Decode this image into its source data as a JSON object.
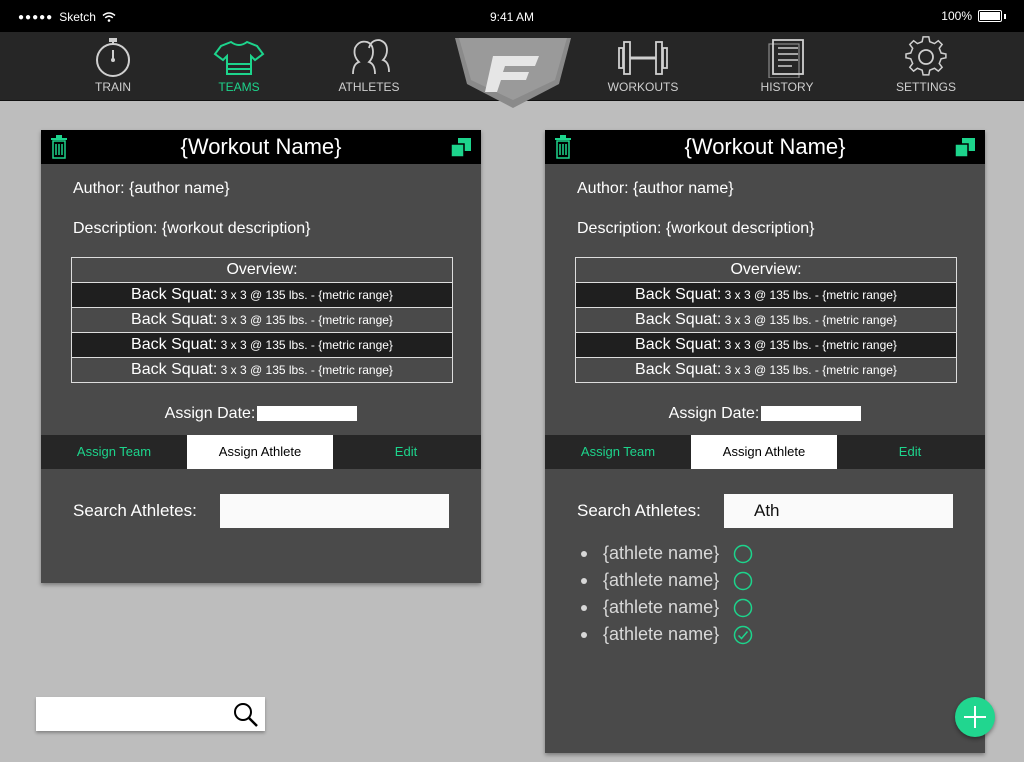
{
  "status_bar": {
    "carrier": "Sketch",
    "time": "9:41 AM",
    "battery": "100%"
  },
  "nav": {
    "items": [
      {
        "label": "TRAIN",
        "icon": "stopwatch-icon"
      },
      {
        "label": "TEAMS",
        "icon": "shirt-icon",
        "active": true
      },
      {
        "label": "ATHLETES",
        "icon": "athletes-icon"
      },
      {
        "label": "WORKOUTS",
        "icon": "barbell-icon"
      },
      {
        "label": "HISTORY",
        "icon": "document-icon"
      },
      {
        "label": "SETTINGS",
        "icon": "gear-icon"
      }
    ],
    "logo": "F"
  },
  "colors": {
    "accent": "#1dd48c",
    "panel": "#4a4a4a",
    "header": "#000000",
    "nav": "#262626"
  },
  "cards": [
    {
      "title": "{Workout Name}",
      "author": "Author: {author name}",
      "description": "Description: {workout description}",
      "overview_title": "Overview:",
      "overview_rows": [
        {
          "exercise": "Back Squat:",
          "detail": " 3 x 3 @ 135 lbs. - {metric range}"
        },
        {
          "exercise": "Back Squat:",
          "detail": " 3 x 3 @ 135 lbs. - {metric range}"
        },
        {
          "exercise": "Back Squat:",
          "detail": " 3 x 3 @ 135 lbs. - {metric range}"
        },
        {
          "exercise": "Back Squat:",
          "detail": " 3 x 3 @ 135 lbs. - {metric range}"
        }
      ],
      "assign_date_label": "Assign Date:",
      "tabs": [
        "Assign Team",
        "Assign Athlete",
        "Edit"
      ],
      "search_label": "Search Athletes:",
      "search_value": ""
    },
    {
      "title": "{Workout Name}",
      "author": "Author: {author name}",
      "description": "Description: {workout description}",
      "overview_title": "Overview:",
      "overview_rows": [
        {
          "exercise": "Back Squat:",
          "detail": " 3 x 3 @ 135 lbs. - {metric range}"
        },
        {
          "exercise": "Back Squat:",
          "detail": " 3 x 3 @ 135 lbs. - {metric range}"
        },
        {
          "exercise": "Back Squat:",
          "detail": " 3 x 3 @ 135 lbs. - {metric range}"
        },
        {
          "exercise": "Back Squat:",
          "detail": " 3 x 3 @ 135 lbs. - {metric range}"
        }
      ],
      "assign_date_label": "Assign Date:",
      "tabs": [
        "Assign Team",
        "Assign Athlete",
        "Edit"
      ],
      "search_label": "Search Athletes:",
      "search_value": "Ath",
      "athletes": [
        {
          "name": "{athlete name}",
          "checked": false
        },
        {
          "name": "{athlete name}",
          "checked": false
        },
        {
          "name": "{athlete name}",
          "checked": false
        },
        {
          "name": "{athlete name}",
          "checked": true
        }
      ]
    }
  ]
}
